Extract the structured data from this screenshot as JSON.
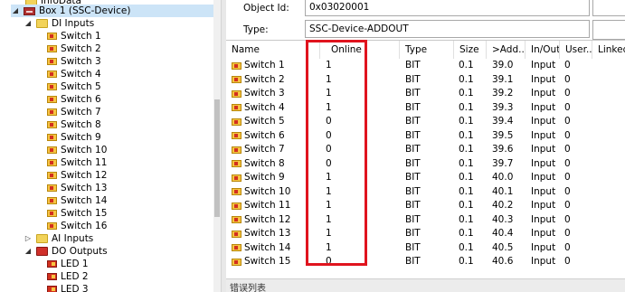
{
  "tree": {
    "top_cut_label": "InfoData",
    "box": "Box 1 (SSC-Device)",
    "di_folder": "DI Inputs",
    "switches": [
      "Switch 1",
      "Switch 2",
      "Switch 3",
      "Switch 4",
      "Switch 5",
      "Switch 6",
      "Switch 7",
      "Switch 8",
      "Switch 9",
      "Switch 10",
      "Switch 11",
      "Switch 12",
      "Switch 13",
      "Switch 14",
      "Switch 15",
      "Switch 16"
    ],
    "ai_folder": "AI Inputs",
    "do_folder": "DO Outputs",
    "leds": [
      "LED 1",
      "LED 2",
      "LED 3"
    ]
  },
  "details": {
    "object_id_label": "Object Id:",
    "object_id_value": "0x03020001",
    "type_label": "Type:",
    "type_value": "SSC-Device-ADDOUT"
  },
  "grid": {
    "headers": [
      "Name",
      "Online",
      "Type",
      "Size",
      ">Add...",
      "In/Out",
      "User...",
      "Linked"
    ],
    "rows": [
      {
        "name": "Switch 1",
        "online": "1",
        "type": "BIT",
        "size": "0.1",
        "addr": "39.0",
        "io": "Input",
        "user": "0"
      },
      {
        "name": "Switch 2",
        "online": "1",
        "type": "BIT",
        "size": "0.1",
        "addr": "39.1",
        "io": "Input",
        "user": "0"
      },
      {
        "name": "Switch 3",
        "online": "1",
        "type": "BIT",
        "size": "0.1",
        "addr": "39.2",
        "io": "Input",
        "user": "0"
      },
      {
        "name": "Switch 4",
        "online": "1",
        "type": "BIT",
        "size": "0.1",
        "addr": "39.3",
        "io": "Input",
        "user": "0"
      },
      {
        "name": "Switch 5",
        "online": "0",
        "type": "BIT",
        "size": "0.1",
        "addr": "39.4",
        "io": "Input",
        "user": "0"
      },
      {
        "name": "Switch 6",
        "online": "0",
        "type": "BIT",
        "size": "0.1",
        "addr": "39.5",
        "io": "Input",
        "user": "0"
      },
      {
        "name": "Switch 7",
        "online": "0",
        "type": "BIT",
        "size": "0.1",
        "addr": "39.6",
        "io": "Input",
        "user": "0"
      },
      {
        "name": "Switch 8",
        "online": "0",
        "type": "BIT",
        "size": "0.1",
        "addr": "39.7",
        "io": "Input",
        "user": "0"
      },
      {
        "name": "Switch 9",
        "online": "1",
        "type": "BIT",
        "size": "0.1",
        "addr": "40.0",
        "io": "Input",
        "user": "0"
      },
      {
        "name": "Switch 10",
        "online": "1",
        "type": "BIT",
        "size": "0.1",
        "addr": "40.1",
        "io": "Input",
        "user": "0"
      },
      {
        "name": "Switch 11",
        "online": "1",
        "type": "BIT",
        "size": "0.1",
        "addr": "40.2",
        "io": "Input",
        "user": "0"
      },
      {
        "name": "Switch 12",
        "online": "1",
        "type": "BIT",
        "size": "0.1",
        "addr": "40.3",
        "io": "Input",
        "user": "0"
      },
      {
        "name": "Switch 13",
        "online": "1",
        "type": "BIT",
        "size": "0.1",
        "addr": "40.4",
        "io": "Input",
        "user": "0"
      },
      {
        "name": "Switch 14",
        "online": "1",
        "type": "BIT",
        "size": "0.1",
        "addr": "40.5",
        "io": "Input",
        "user": "0"
      },
      {
        "name": "Switch 15",
        "online": "0",
        "type": "BIT",
        "size": "0.1",
        "addr": "40.6",
        "io": "Input",
        "user": "0"
      }
    ]
  },
  "status_bar": {
    "label": "错误列表"
  },
  "colors": {
    "highlight": "#e0141e",
    "selection": "#cce4f7"
  }
}
